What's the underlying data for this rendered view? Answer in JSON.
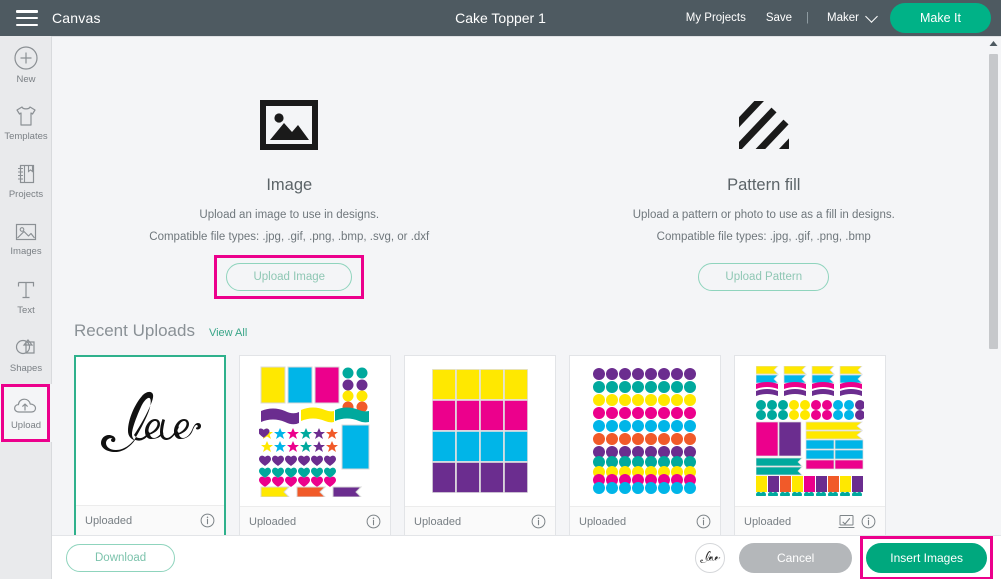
{
  "header": {
    "menu_icon": "hamburger-icon",
    "canvas_label": "Canvas",
    "project_title": "Cake Topper 1",
    "my_projects_label": "My Projects",
    "save_label": "Save",
    "separator": "|",
    "machine_label": "Maker",
    "machine_chevron_icon": "chevron-down-icon",
    "make_it_label": "Make It",
    "accent_color": "#00b287",
    "bar_color": "#4e5a61"
  },
  "sidebar": {
    "items": [
      {
        "label": "New",
        "icon": "plus-circle-icon",
        "active": false
      },
      {
        "label": "Templates",
        "icon": "tshirt-icon",
        "active": false
      },
      {
        "label": "Projects",
        "icon": "notebook-icon",
        "active": false
      },
      {
        "label": "Images",
        "icon": "photo-icon",
        "active": false
      },
      {
        "label": "Text",
        "icon": "text-t-icon",
        "active": false
      },
      {
        "label": "Shapes",
        "icon": "shapes-icon",
        "active": false
      },
      {
        "label": "Upload",
        "icon": "cloud-upload-icon",
        "active": true,
        "highlighted": true
      }
    ],
    "highlight_color": "#ec008c"
  },
  "upload_tiles": [
    {
      "icon": "image-placeholder-icon",
      "title": "Image",
      "description": "Upload an image to use in designs.",
      "file_types": "Compatible file types: .jpg, .gif, .png, .bmp, .svg, or .dxf",
      "button_label": "Upload Image",
      "highlighted": true
    },
    {
      "icon": "diagonal-stripes-icon",
      "title": "Pattern fill",
      "description": "Upload a pattern or photo to use as a fill in designs.",
      "file_types": "Compatible file types: .jpg, .gif, .png, .bmp",
      "button_label": "Upload Pattern",
      "highlighted": false
    }
  ],
  "recent_uploads": {
    "title": "Recent Uploads",
    "view_all_label": "View All",
    "cards": [
      {
        "status": "Uploaded",
        "thumb": "love-script",
        "selected": true,
        "has_screen_icon": false,
        "info_icon": "info-icon"
      },
      {
        "status": "Uploaded",
        "thumb": "sticker-sheet-mixed",
        "selected": false,
        "has_screen_icon": false,
        "info_icon": "info-icon"
      },
      {
        "status": "Uploaded",
        "thumb": "color-grid",
        "selected": false,
        "has_screen_icon": false,
        "info_icon": "info-icon"
      },
      {
        "status": "Uploaded",
        "thumb": "dot-grid",
        "selected": false,
        "has_screen_icon": false,
        "info_icon": "info-icon"
      },
      {
        "status": "Uploaded",
        "thumb": "sticker-sheet-dense",
        "selected": false,
        "has_screen_icon": true,
        "screen_icon": "screen-check-icon",
        "info_icon": "info-icon"
      }
    ]
  },
  "footer": {
    "download_label": "Download",
    "selected_thumb": "love-script",
    "cancel_label": "Cancel",
    "insert_label": "Insert Images",
    "insert_highlighted": true,
    "insert_color": "#00a87e",
    "cancel_color": "#b4b7ba"
  },
  "scrollbar": {
    "up_arrow_icon": "caret-up-icon"
  },
  "palette": {
    "yellow": "#ffe800",
    "cyan": "#00b5e8",
    "magenta": "#ec008c",
    "purple": "#6b2d8f",
    "teal": "#00a99d",
    "orange": "#f15a29"
  }
}
